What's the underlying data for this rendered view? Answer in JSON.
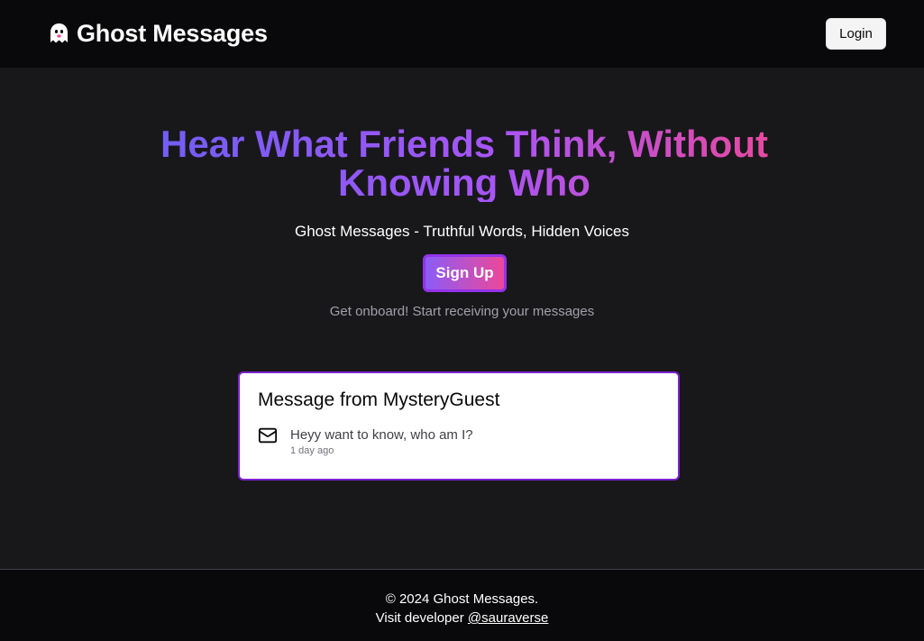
{
  "header": {
    "brand_icon": "ghost-icon",
    "title": "Ghost Messages",
    "login_label": "Login"
  },
  "hero": {
    "headline_line1": "Hear What Friends Think, Without",
    "headline_line2": "Knowing Who",
    "tagline": "Ghost Messages - Truthful Words, Hidden Voices",
    "signup_label": "Sign Up",
    "subtext": "Get onboard! Start receiving your messages"
  },
  "message_card": {
    "title": "Message from MysteryGuest",
    "icon": "mail-icon",
    "message": "Heyy want to know, who am I?",
    "time": "1 day ago"
  },
  "footer": {
    "copyright": "© 2024 Ghost Messages.",
    "visit_prefix": "Visit developer ",
    "developer_handle": "@sauraverse"
  },
  "colors": {
    "background": "#18181b",
    "header_bg": "#09090b",
    "gradient_start": "#6d5ef5",
    "gradient_end": "#ec4899",
    "card_border": "#7e22ce"
  }
}
